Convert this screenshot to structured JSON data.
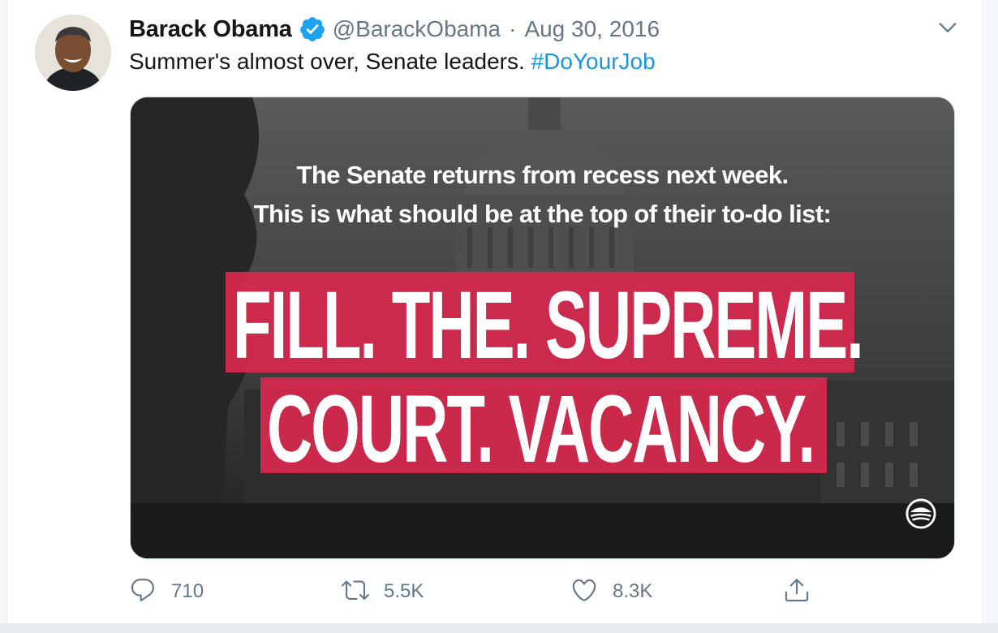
{
  "tweet": {
    "author_name": "Barack Obama",
    "handle": "@BarackObama",
    "separator": "·",
    "date": "Aug 30, 2016",
    "text": "Summer's almost over, Senate leaders.",
    "hashtag": "#DoYourJob",
    "avatar_icon": "avatar-photo",
    "verified_icon": "verified-badge-icon",
    "more_icon": "chevron-down-icon"
  },
  "media": {
    "line1": "The Senate returns from recess next week.",
    "line2": "This is what should be at the top of their to-do list:",
    "headline_line1": "FILL. THE. SUPREME.",
    "headline_line2": "COURT. VACANCY.",
    "logo_icon": "obama-rising-sun-logo"
  },
  "actions": {
    "reply": {
      "icon": "reply-icon",
      "count": "710"
    },
    "retweet": {
      "icon": "retweet-icon",
      "count": "5.5K"
    },
    "like": {
      "icon": "heart-icon",
      "count": "8.3K"
    },
    "share": {
      "icon": "share-icon"
    }
  },
  "colors": {
    "link": "#1b95e0",
    "verified": "#1da1f2",
    "highlight": "#d6294f",
    "muted": "#657786"
  }
}
